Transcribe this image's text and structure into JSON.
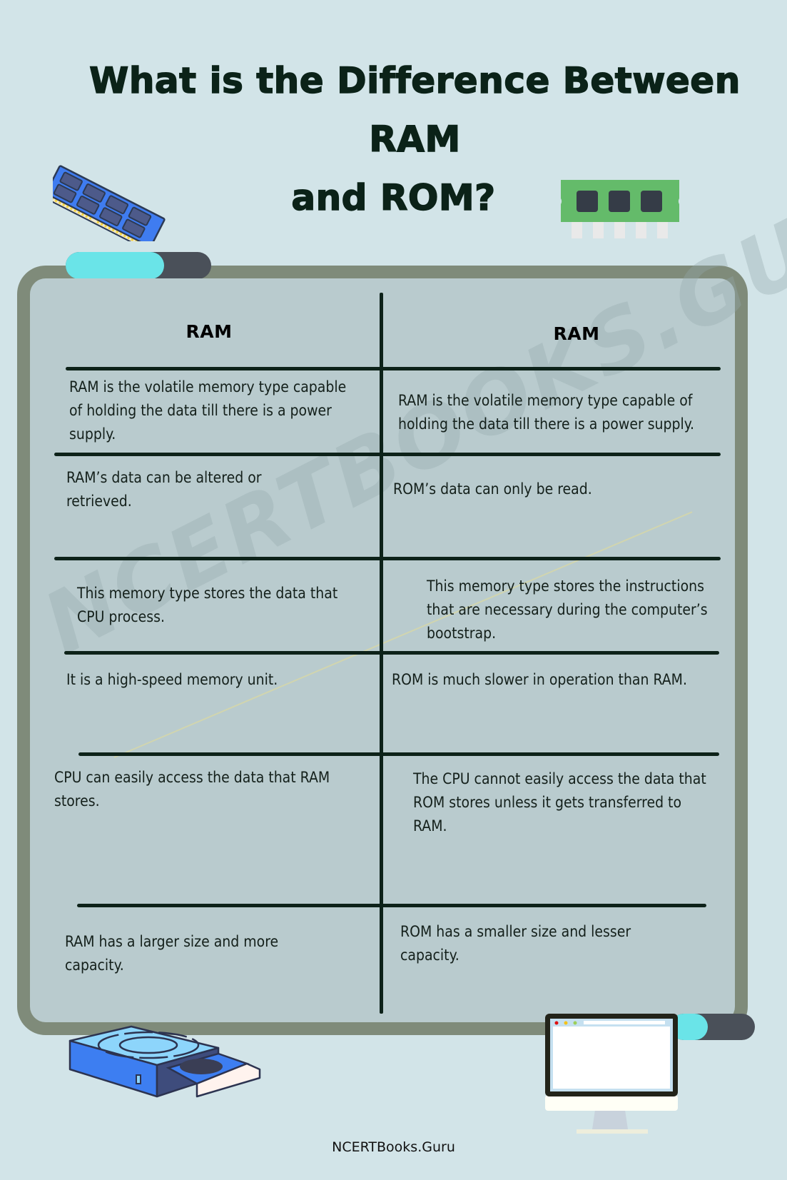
{
  "title": {
    "line1": "What is the Difference Between RAM",
    "line2": "and ROM?"
  },
  "table": {
    "headers": [
      "RAM",
      "RAM"
    ],
    "rows": [
      [
        "RAM is the volatile memory type capable of holding the data till there is a power supply.",
        "RAM is the volatile memory type capable of holding the data till there is a power supply."
      ],
      [
        "RAM’s data can be altered or retrieved.",
        "ROM’s data can only be read."
      ],
      [
        "This memory type stores the data that CPU process.",
        "This memory type stores the instructions that are necessary during the computer’s bootstrap."
      ],
      [
        "It is a high-speed memory unit.",
        "ROM is much slower in operation than RAM."
      ],
      [
        "CPU can easily access the data that RAM stores.",
        "The CPU cannot easily access the data that ROM stores unless it gets transferred to RAM."
      ],
      [
        "RAM has a larger size and more capacity.",
        "ROM has a smaller size and lesser capacity."
      ]
    ]
  },
  "watermark": "NCERTBOOKS.GURU",
  "footer": "NCERTBooks.Guru",
  "icons": {
    "top_left": "ram-module-icon",
    "top_right": "memory-chip-icon",
    "bottom_left": "optical-drive-icon",
    "bottom_right": "desktop-monitor-icon"
  },
  "colors": {
    "background": "#d2e4e8",
    "frame": "#7f8b7a",
    "panel": "#b9cbce",
    "accent_cyan": "#6ae4e8",
    "accent_dark": "#4a5059",
    "text": "#0b2218"
  }
}
